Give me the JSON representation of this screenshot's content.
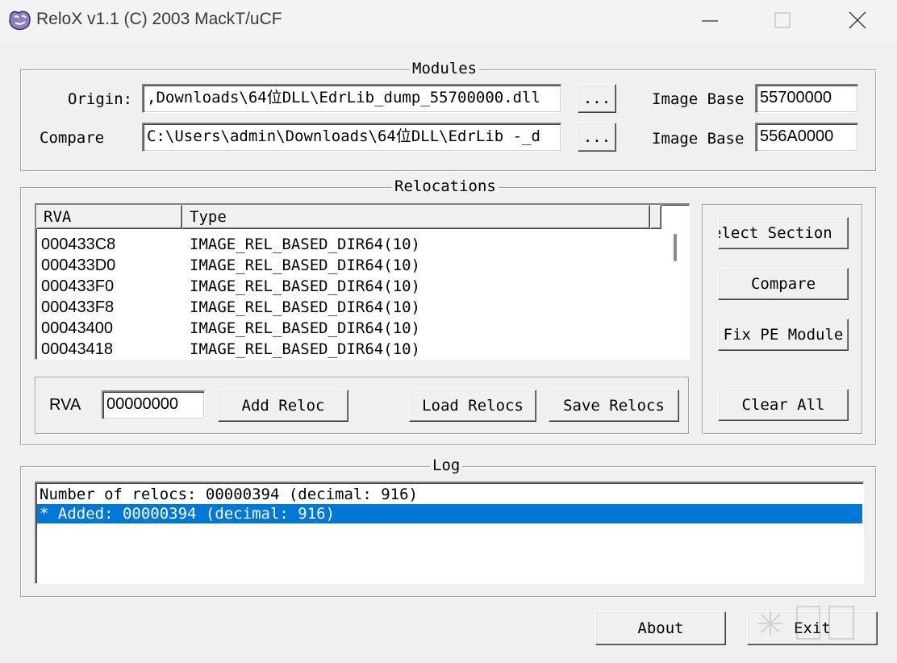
{
  "window": {
    "title": "ReloX v1.1 (C) 2003 MackT/uCF"
  },
  "modules": {
    "caption": "Modules",
    "origin_label": "Origin:",
    "origin_path": ",Downloads\\64位DLL\\EdrLib_dump_55700000.dll",
    "origin_browse": "...",
    "origin_imagebase_label": "Image Base",
    "origin_imagebase": "55700000",
    "compare_label": "Compare",
    "compare_path": "C:\\Users\\admin\\Downloads\\64位DLL\\EdrLib -_d",
    "compare_browse": "...",
    "compare_imagebase_label": "Image Base",
    "compare_imagebase": "556A0000"
  },
  "relocations": {
    "caption": "Relocations",
    "columns": [
      "RVA",
      "Type"
    ],
    "rows": [
      {
        "rva": "000433C8",
        "type": "IMAGE_REL_BASED_DIR64(10)"
      },
      {
        "rva": "000433D0",
        "type": "IMAGE_REL_BASED_DIR64(10)"
      },
      {
        "rva": "000433F0",
        "type": "IMAGE_REL_BASED_DIR64(10)"
      },
      {
        "rva": "000433F8",
        "type": "IMAGE_REL_BASED_DIR64(10)"
      },
      {
        "rva": "00043400",
        "type": "IMAGE_REL_BASED_DIR64(10)"
      },
      {
        "rva": "00043418",
        "type": "IMAGE_REL_BASED_DIR64(10)"
      }
    ],
    "rva_label": "RVA",
    "rva_value": "00000000",
    "add_reloc": "Add Reloc",
    "load_relocs": "Load Relocs",
    "save_relocs": "Save Relocs",
    "select_section": "elect Section",
    "compare": "Compare",
    "fix_pe_module": "Fix PE Module",
    "clear_all": "Clear All"
  },
  "log": {
    "caption": "Log",
    "lines": [
      "Number of relocs: 00000394 (decimal: 916)",
      "* Added: 00000394 (decimal: 916)"
    ],
    "selected_index": 1
  },
  "footer": {
    "about": "About",
    "exit": "Exit"
  },
  "colors": {
    "selection": "#0078d7",
    "face": "#f0f0f0"
  }
}
